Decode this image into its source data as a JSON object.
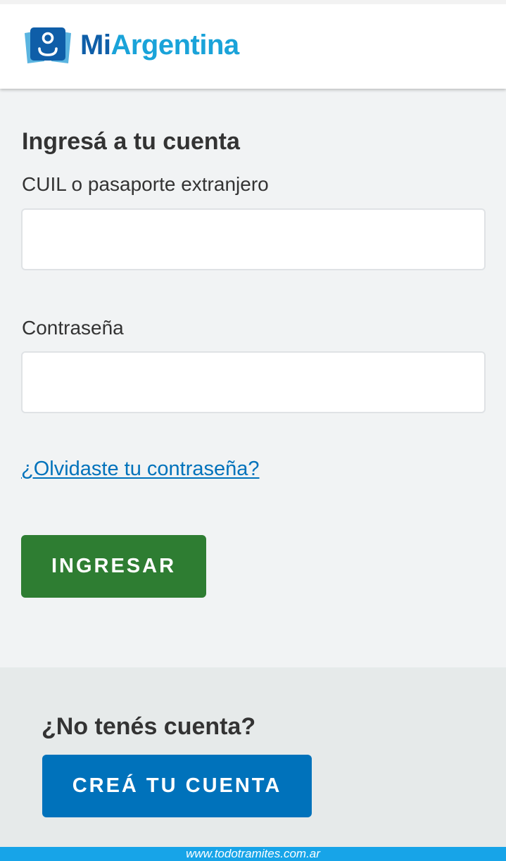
{
  "header": {
    "brand_mi": "Mi",
    "brand_argentina": "Argentina",
    "logo_icon": "person-card-icon"
  },
  "login": {
    "title": "Ingresá a tu cuenta",
    "cuil_label": "CUIL o pasaporte extranjero",
    "cuil_value": "",
    "cuil_placeholder": "",
    "password_label": "Contraseña",
    "password_value": "",
    "password_placeholder": "",
    "forgot_link": "¿Olvidaste tu contraseña?",
    "submit_label": "INGRESAR"
  },
  "register": {
    "title": "¿No tenés cuenta?",
    "button_label": "CREÁ TU CUENTA"
  },
  "watermark": {
    "text": "www.todotramites.com.ar"
  },
  "colors": {
    "brand_dark_blue": "#0f5ea8",
    "brand_light_blue": "#1aa3d9",
    "link_blue": "#0072bb",
    "primary_green": "#2e7d32",
    "create_account_blue": "#0072bb",
    "watermark_bar": "#17a4e8",
    "page_background": "#f1f3f4",
    "register_background": "#e6eaea"
  }
}
